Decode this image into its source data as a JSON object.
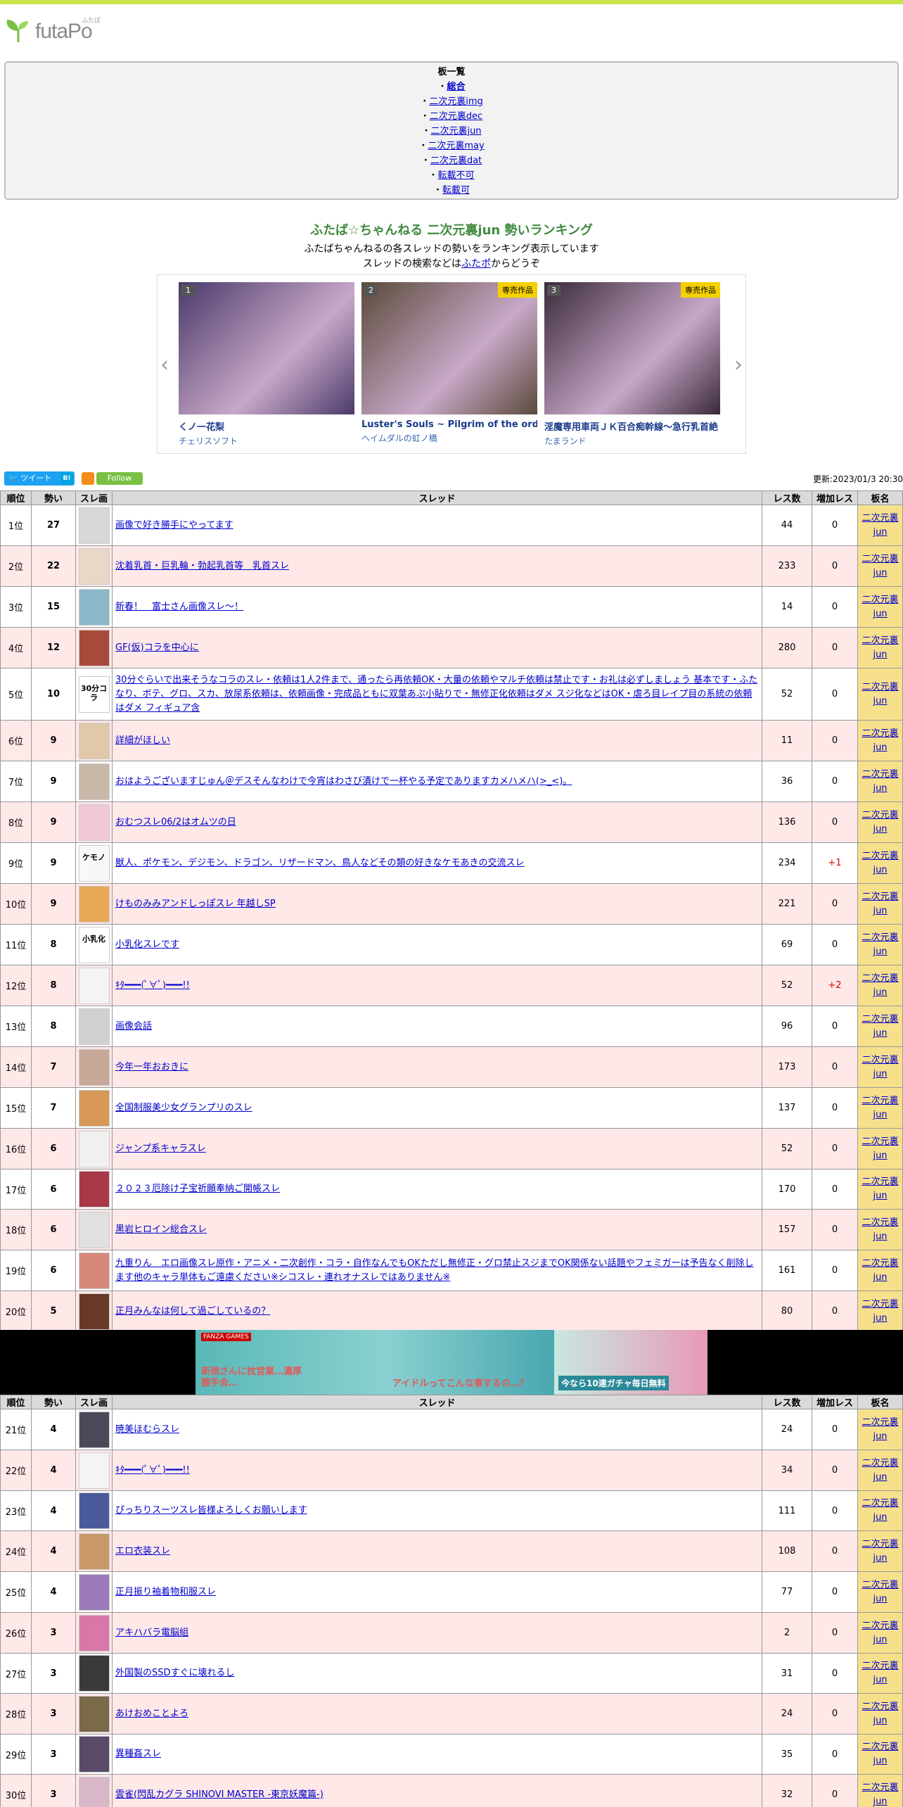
{
  "logo": {
    "text": "futaPo",
    "sub": "ふたぽ"
  },
  "boards": {
    "title": "板一覧",
    "items": [
      {
        "label": "総合",
        "current": true
      },
      {
        "label": "二次元裏img"
      },
      {
        "label": "二次元裏dec"
      },
      {
        "label": "二次元裏jun"
      },
      {
        "label": "二次元裏may"
      },
      {
        "label": "二次元裏dat"
      },
      {
        "label": "転載不可"
      },
      {
        "label": "転載可"
      }
    ]
  },
  "heading": {
    "title": "ふたば☆ちゃんねる 二次元裏jun 勢いランキング",
    "desc1": "ふたばちゃんねるの各スレッドの勢いをランキング表示しています",
    "desc2_pre": "スレッドの検索などは",
    "desc2_link": "ふたポ",
    "desc2_post": "からどうぞ"
  },
  "carousel": [
    {
      "num": "1",
      "badge": "",
      "name": "くノ一花梨",
      "circle": "チェリスソフト",
      "color": "#4a3a6a"
    },
    {
      "num": "2",
      "badge": "専売作品",
      "name": "Luster's Souls ~ Pilgrim of the ordeal",
      "circle": "ヘイムダルの虹ノ橋",
      "color": "#5a4a3a"
    },
    {
      "num": "3",
      "badge": "専売作品",
      "name": "淫魔専用車両ＪＫ百合痴幹線〜急行乳首絶",
      "circle": "たまランド",
      "color": "#3a2a3a"
    }
  ],
  "share": {
    "tweet": "ツイート",
    "hatena": "B!",
    "follow": "Follow"
  },
  "updated": "更新:2023/01/3 20:30",
  "table": {
    "headers": [
      "順位",
      "勢い",
      "スレ画",
      "スレッド",
      "レス数",
      "増加レス",
      "板名"
    ],
    "board_name": "二次元裏jun",
    "rows_a": [
      {
        "pos": "1位",
        "ikioi": "27",
        "title": "画像で好き勝手にやってます",
        "res": "44",
        "inc": "0",
        "thumb": "#d8d8d8"
      },
      {
        "pos": "2位",
        "ikioi": "22",
        "title": "沈着乳首・巨乳輪・勃起乳首等　乳首スレ",
        "res": "233",
        "inc": "0",
        "thumb": "#e8d8c8"
      },
      {
        "pos": "3位",
        "ikioi": "15",
        "title": "新春！　富士さん画像スレ～！",
        "res": "14",
        "inc": "0",
        "thumb": "#8ab8c8"
      },
      {
        "pos": "4位",
        "ikioi": "12",
        "title": "GF(仮)コラを中心に",
        "res": "280",
        "inc": "0",
        "thumb": "#a84a3a"
      },
      {
        "pos": "5位",
        "ikioi": "10",
        "title": "30分ぐらいで出来そうなコラのスレ・依頼は1人2件まで、通ったら再依頼OK・大量の依頼やマルチ依頼は禁止です・お礼は必ずしましょう 基本です・ふたなり、ボテ、グロ、スカ、放尿系依頼は、依頼画像・完成品ともに双葉あぷ小貼りで・無修正化依頼はダメ スジ化などはOK・虐ろ目レイプ目の系統の依頼はダメ フィギュア含",
        "res": "52",
        "inc": "0",
        "thumb": "#ffffff",
        "thumbtext": "30分コラ"
      },
      {
        "pos": "6位",
        "ikioi": "9",
        "title": "詳細がほしい",
        "res": "11",
        "inc": "0",
        "thumb": "#e0c8a8"
      },
      {
        "pos": "7位",
        "ikioi": "9",
        "title": "おはようございますじゅん＠デスそんなわけで今宵はわさび漬けで一杯やる予定でありますカメハメハ(>_<)。",
        "res": "36",
        "inc": "0",
        "thumb": "#c8b8a8"
      },
      {
        "pos": "8位",
        "ikioi": "9",
        "title": "おむつスレ06/2はオムツの日",
        "res": "136",
        "inc": "0",
        "thumb": "#f0c8d8"
      },
      {
        "pos": "9位",
        "ikioi": "9",
        "title": "獣人、ポケモン、デジモン、ドラゴン、リザードマン、鳥人などその類の好きなケモあきの交流スレ",
        "res": "234",
        "inc": "+1",
        "thumb": "#f8f8f8",
        "thumbtext": "ケモノ"
      },
      {
        "pos": "10位",
        "ikioi": "9",
        "title": "けものみみアンドしっぽスレ 年越しSP",
        "res": "221",
        "inc": "0",
        "thumb": "#e8a858"
      },
      {
        "pos": "11位",
        "ikioi": "8",
        "title": "小乳化スレです",
        "res": "69",
        "inc": "0",
        "thumb": "#ffffff",
        "thumbtext": "小乳化"
      },
      {
        "pos": "12位",
        "ikioi": "8",
        "title": "ｷﾀ━━━(ﾟ∀ﾟ)━━━!!",
        "res": "52",
        "inc": "+2",
        "thumb": "#f4f4f4"
      },
      {
        "pos": "13位",
        "ikioi": "8",
        "title": "画像会話",
        "res": "96",
        "inc": "0",
        "thumb": "#d0d0d0"
      },
      {
        "pos": "14位",
        "ikioi": "7",
        "title": "今年一年おおきに",
        "res": "173",
        "inc": "0",
        "thumb": "#c8a898"
      },
      {
        "pos": "15位",
        "ikioi": "7",
        "title": "全国制服美少女グランプリのスレ",
        "res": "137",
        "inc": "0",
        "thumb": "#d89858"
      },
      {
        "pos": "16位",
        "ikioi": "6",
        "title": "ジャンプ系キャラスレ",
        "res": "52",
        "inc": "0",
        "thumb": "#f0f0f0"
      },
      {
        "pos": "17位",
        "ikioi": "6",
        "title": "２０２３厄除け子宝祈願奉納ご開帳スレ",
        "res": "170",
        "inc": "0",
        "thumb": "#a83848"
      },
      {
        "pos": "18位",
        "ikioi": "6",
        "title": "黒岩ヒロイン総合スレ",
        "res": "157",
        "inc": "0",
        "thumb": "#e0e0e0"
      },
      {
        "pos": "19位",
        "ikioi": "6",
        "title": "九重りん　エロ画像スレ原作・アニメ・二次創作・コラ・自作なんでもOKただし無修正・グロ禁止スジまでOK関係ない話題やフェミガーは予告なく削除します他のキャラ単体もご遠慮ください※シコスレ・連れオナスレではありません※",
        "res": "161",
        "inc": "0",
        "thumb": "#d88878"
      },
      {
        "pos": "20位",
        "ikioi": "5",
        "title": "正月みんなは何して過ごしているの？",
        "res": "80",
        "inc": "0",
        "thumb": "#6a3828"
      }
    ],
    "rows_b": [
      {
        "pos": "21位",
        "ikioi": "4",
        "title": "暁美ほむらスレ",
        "res": "24",
        "inc": "0",
        "thumb": "#4a4a5a"
      },
      {
        "pos": "22位",
        "ikioi": "4",
        "title": "ｷﾀ━━━(ﾟ∀ﾟ)━━━!!",
        "res": "34",
        "inc": "0",
        "thumb": "#f4f4f4"
      },
      {
        "pos": "23位",
        "ikioi": "4",
        "title": "ぴっちりスーツスレ皆様よろしくお願いします",
        "res": "111",
        "inc": "0",
        "thumb": "#4a5a9a"
      },
      {
        "pos": "24位",
        "ikioi": "4",
        "title": "エロ衣装スレ",
        "res": "108",
        "inc": "0",
        "thumb": "#c89868"
      },
      {
        "pos": "25位",
        "ikioi": "4",
        "title": "正月振り袖着物和服スレ",
        "res": "77",
        "inc": "0",
        "thumb": "#9a7ab8"
      },
      {
        "pos": "26位",
        "ikioi": "3",
        "title": "アキハバラ電脳組",
        "res": "2",
        "inc": "0",
        "thumb": "#d878a8"
      },
      {
        "pos": "27位",
        "ikioi": "3",
        "title": "外国製のSSDすぐに壊れるし",
        "res": "31",
        "inc": "0",
        "thumb": "#3a3a3a"
      },
      {
        "pos": "28位",
        "ikioi": "3",
        "title": "あけおめことよろ",
        "res": "24",
        "inc": "0",
        "thumb": "#7a6a4a"
      },
      {
        "pos": "29位",
        "ikioi": "3",
        "title": "異種姦スレ",
        "res": "35",
        "inc": "0",
        "thumb": "#5a4a6a"
      },
      {
        "pos": "30位",
        "ikioi": "3",
        "title": "雲雀(閃乱カグラ SHINOVI MASTER -東京妖魔篇-)",
        "res": "32",
        "inc": "0",
        "thumb": "#d8b8c8"
      }
    ]
  },
  "ad": {
    "text1": "新規さんに枕営業…濃厚握手会…",
    "text2": "アイドルってこんな事するの…？",
    "text3": "今なら10連ガチャ毎日無料"
  }
}
